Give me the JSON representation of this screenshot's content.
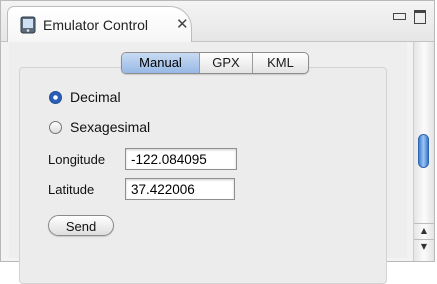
{
  "view": {
    "title": "Emulator Control",
    "close_glyph": "✕",
    "icon": "emulator-device-icon"
  },
  "location_tabs": [
    {
      "label": "Manual",
      "selected": true
    },
    {
      "label": "GPX",
      "selected": false
    },
    {
      "label": "KML",
      "selected": false
    }
  ],
  "format": {
    "options": [
      {
        "label": "Decimal",
        "checked": true
      },
      {
        "label": "Sexagesimal",
        "checked": false
      }
    ]
  },
  "fields": {
    "longitude_label": "Longitude",
    "longitude_value": "-122.084095",
    "latitude_label": "Latitude",
    "latitude_value": "37.422006"
  },
  "send_label": "Send",
  "scrollbar": {
    "up_glyph": "▲",
    "down_glyph": "▼"
  },
  "colors": {
    "selected_tab": "#97b9e5",
    "radio_accent": "#2a5fb8",
    "scroll_thumb": "#3d7fd6"
  }
}
